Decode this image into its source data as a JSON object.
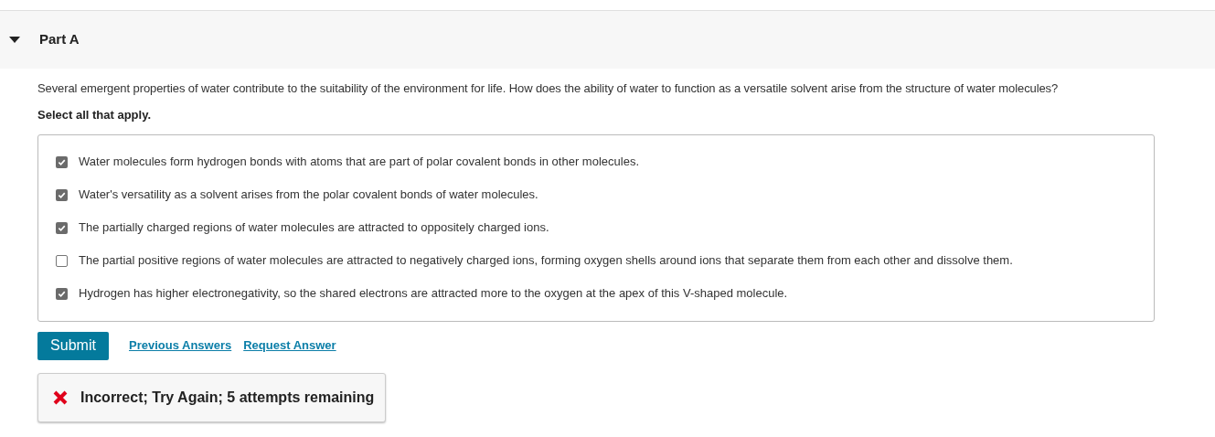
{
  "part": {
    "title": "Part A",
    "expanded": true
  },
  "question": {
    "prompt": "Several emergent properties of water contribute to the suitability of the environment for life. How does the ability of water to function as a versatile solvent arise from the structure of water molecules?",
    "instruction": "Select all that apply."
  },
  "options": [
    {
      "label": "Water molecules form hydrogen bonds with atoms that are part of polar covalent bonds in other molecules.",
      "checked": true
    },
    {
      "label": "Water's versatility as a solvent arises from the polar covalent bonds of water molecules.",
      "checked": true
    },
    {
      "label": "The partially charged regions of water molecules are attracted to oppositely charged ions.",
      "checked": true
    },
    {
      "label": "The partial positive regions of water molecules are attracted to negatively charged ions, forming oxygen shells around ions that separate them from each other and dissolve them.",
      "checked": false
    },
    {
      "label": "Hydrogen has higher electronegativity, so the shared electrons are attracted more to the oxygen at the apex of this V-shaped molecule.",
      "checked": true
    }
  ],
  "actions": {
    "submit": "Submit",
    "links": [
      "Previous Answers",
      "Request Answer"
    ]
  },
  "feedback": {
    "kind": "incorrect",
    "message": "Incorrect; Try Again; 5 attempts remaining"
  }
}
